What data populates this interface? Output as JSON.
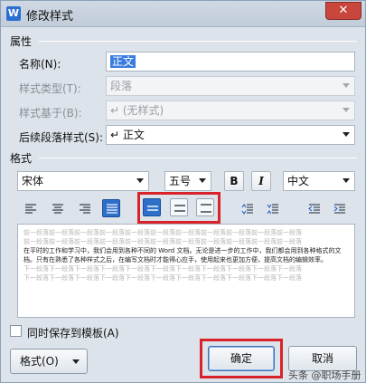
{
  "window": {
    "title": "修改样式",
    "app_icon": "W",
    "close_glyph": "✕"
  },
  "attributes": {
    "section": "属性",
    "name_label": "名称(N):",
    "name_value": "正文",
    "style_type_label": "样式类型(T):",
    "style_type_value": "段落",
    "based_on_label": "样式基于(B):",
    "based_on_value": "↵ (无样式)",
    "next_style_label": "后续段落样式(S):",
    "next_style_value": "↵ 正文"
  },
  "format": {
    "section": "格式",
    "font": "宋体",
    "size": "五号",
    "bold": "B",
    "italic": "I",
    "language": "中文"
  },
  "preview": {
    "gray_line": "前一段落前一段落前一段落前一段落前一段落前一段落前一段落前一段落前一段落前一段落前一段落",
    "main_text": "在平时的工作和学习中，我们会用到各种不同的 Word 文档。无论是进一步的工作中，我们都会用到各种格式的文档。只有在熟悉了各种样式之后，在编写文档时才能得心应手，使用起来也更加方便，提高文档的编辑效率。",
    "after_line": "下一段落下一段落下一段落下一段落下一段落下一段落下一段落下一段落下一段落下一段落下一段落"
  },
  "save_to_template_label": "同时保存到模板(A)",
  "format_button": "格式(O)",
  "ok_button": "确定",
  "cancel_button": "取消",
  "watermark": "头条 @职场手册",
  "colors": {
    "accent": "#2d6fc9",
    "highlight_box": "#d8232a",
    "close": "#c9463d"
  }
}
